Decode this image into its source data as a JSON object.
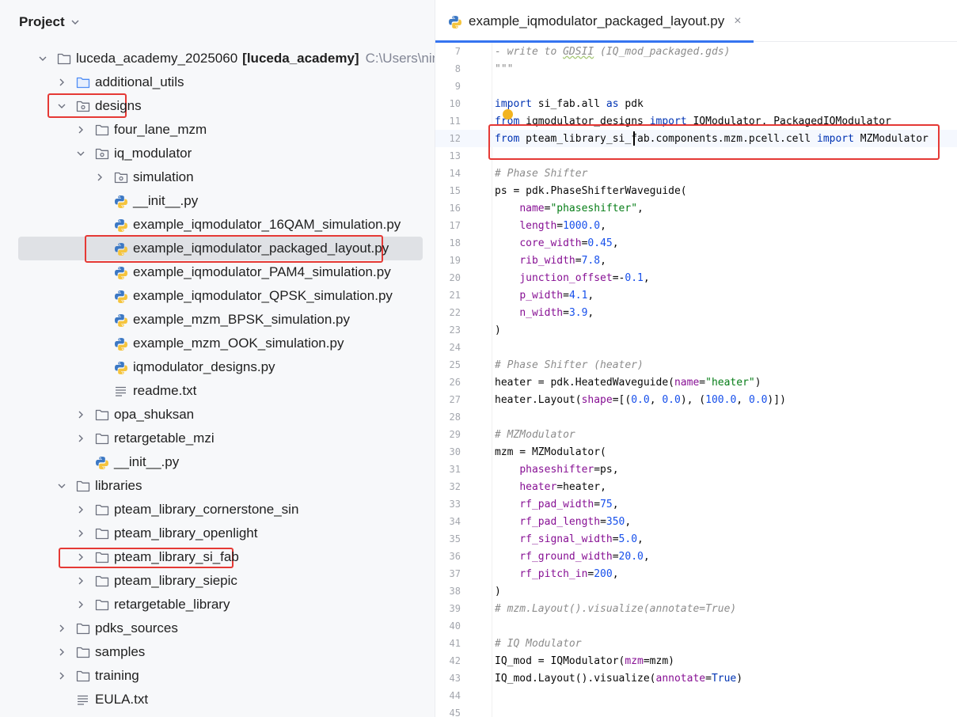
{
  "project_panel": {
    "title": "Project",
    "tree": [
      {
        "depth": 0,
        "expanded": true,
        "icon": "folder",
        "label": "luceda_academy_2025060",
        "suffix_bold": "[luceda_academy]",
        "suffix_path": "C:\\Users\\ning_\\lu"
      },
      {
        "depth": 1,
        "expanded": false,
        "icon": "folder-blue",
        "label": "additional_utils"
      },
      {
        "depth": 1,
        "expanded": true,
        "icon": "package",
        "label": "designs"
      },
      {
        "depth": 2,
        "expanded": false,
        "icon": "folder",
        "label": "four_lane_mzm"
      },
      {
        "depth": 2,
        "expanded": true,
        "icon": "package",
        "label": "iq_modulator"
      },
      {
        "depth": 3,
        "expanded": false,
        "icon": "package",
        "label": "simulation"
      },
      {
        "depth": 3,
        "expanded": null,
        "icon": "python",
        "label": "__init__.py"
      },
      {
        "depth": 3,
        "expanded": null,
        "icon": "python",
        "label": "example_iqmodulator_16QAM_simulation.py"
      },
      {
        "depth": 3,
        "expanded": null,
        "icon": "python",
        "label": "example_iqmodulator_packaged_layout.py",
        "selected": true
      },
      {
        "depth": 3,
        "expanded": null,
        "icon": "python",
        "label": "example_iqmodulator_PAM4_simulation.py"
      },
      {
        "depth": 3,
        "expanded": null,
        "icon": "python",
        "label": "example_iqmodulator_QPSK_simulation.py"
      },
      {
        "depth": 3,
        "expanded": null,
        "icon": "python",
        "label": "example_mzm_BPSK_simulation.py"
      },
      {
        "depth": 3,
        "expanded": null,
        "icon": "python",
        "label": "example_mzm_OOK_simulation.py"
      },
      {
        "depth": 3,
        "expanded": null,
        "icon": "python",
        "label": "iqmodulator_designs.py"
      },
      {
        "depth": 3,
        "expanded": null,
        "icon": "text",
        "label": "readme.txt"
      },
      {
        "depth": 2,
        "expanded": false,
        "icon": "folder",
        "label": "opa_shuksan"
      },
      {
        "depth": 2,
        "expanded": false,
        "icon": "folder",
        "label": "retargetable_mzi"
      },
      {
        "depth": 2,
        "expanded": null,
        "icon": "python",
        "label": "__init__.py"
      },
      {
        "depth": 1,
        "expanded": true,
        "icon": "folder",
        "label": "libraries"
      },
      {
        "depth": 2,
        "expanded": false,
        "icon": "folder",
        "label": "pteam_library_cornerstone_sin"
      },
      {
        "depth": 2,
        "expanded": false,
        "icon": "folder",
        "label": "pteam_library_openlight"
      },
      {
        "depth": 2,
        "expanded": false,
        "icon": "folder",
        "label": "pteam_library_si_fab"
      },
      {
        "depth": 2,
        "expanded": false,
        "icon": "folder",
        "label": "pteam_library_siepic"
      },
      {
        "depth": 2,
        "expanded": false,
        "icon": "folder",
        "label": "retargetable_library"
      },
      {
        "depth": 1,
        "expanded": false,
        "icon": "folder",
        "label": "pdks_sources"
      },
      {
        "depth": 1,
        "expanded": false,
        "icon": "folder",
        "label": "samples"
      },
      {
        "depth": 1,
        "expanded": false,
        "icon": "folder",
        "label": "training"
      },
      {
        "depth": 1,
        "expanded": null,
        "icon": "text",
        "label": "EULA.txt"
      }
    ]
  },
  "editor": {
    "tab_label": "example_iqmodulator_packaged_layout.py",
    "tab_close": "×",
    "current_line": 12,
    "lines": [
      {
        "n": "7",
        "tokens": [
          [
            "com",
            "- write to "
          ],
          [
            "com squig",
            "GDSII"
          ],
          [
            "com",
            " (IQ_mod_packaged.gds)"
          ]
        ]
      },
      {
        "n": "8",
        "tokens": [
          [
            "com",
            "\"\"\""
          ]
        ]
      },
      {
        "n": "9",
        "tokens": []
      },
      {
        "n": "10",
        "tokens": [
          [
            "kw",
            "import"
          ],
          [
            "",
            " si_fab.all "
          ],
          [
            "kw",
            "as"
          ],
          [
            "",
            " pdk"
          ]
        ]
      },
      {
        "n": "11",
        "tokens": [
          [
            "kw",
            "from"
          ],
          [
            "",
            " iqmodulator_designs "
          ],
          [
            "kw",
            "import"
          ],
          [
            "",
            " IQModulator, PackagedIQModulator"
          ]
        ]
      },
      {
        "n": "12",
        "tokens": [
          [
            "kw",
            "from"
          ],
          [
            "",
            " pteam_library_si_fab.components.mzm.pcell.cell "
          ],
          [
            "kw",
            "import"
          ],
          [
            "",
            " MZModulator"
          ]
        ]
      },
      {
        "n": "13",
        "tokens": []
      },
      {
        "n": "14",
        "tokens": [
          [
            "com",
            "# Phase Shifter"
          ]
        ]
      },
      {
        "n": "15",
        "tokens": [
          [
            "",
            "ps = pdk.PhaseShifterWaveguide("
          ]
        ]
      },
      {
        "n": "16",
        "tokens": [
          [
            "",
            "    "
          ],
          [
            "par",
            "name"
          ],
          [
            "",
            "="
          ],
          [
            "str",
            "\"phaseshifter\""
          ],
          [
            "",
            ","
          ]
        ]
      },
      {
        "n": "17",
        "tokens": [
          [
            "",
            "    "
          ],
          [
            "par",
            "length"
          ],
          [
            "",
            "="
          ],
          [
            "num",
            "1000.0"
          ],
          [
            "",
            ","
          ]
        ]
      },
      {
        "n": "18",
        "tokens": [
          [
            "",
            "    "
          ],
          [
            "par",
            "core_width"
          ],
          [
            "",
            "="
          ],
          [
            "num",
            "0.45"
          ],
          [
            "",
            ","
          ]
        ]
      },
      {
        "n": "19",
        "tokens": [
          [
            "",
            "    "
          ],
          [
            "par",
            "rib_width"
          ],
          [
            "",
            "="
          ],
          [
            "num",
            "7.8"
          ],
          [
            "",
            ","
          ]
        ]
      },
      {
        "n": "20",
        "tokens": [
          [
            "",
            "    "
          ],
          [
            "par",
            "junction_offset"
          ],
          [
            "",
            "=-"
          ],
          [
            "num",
            "0.1"
          ],
          [
            "",
            ","
          ]
        ]
      },
      {
        "n": "21",
        "tokens": [
          [
            "",
            "    "
          ],
          [
            "par",
            "p_width"
          ],
          [
            "",
            "="
          ],
          [
            "num",
            "4.1"
          ],
          [
            "",
            ","
          ]
        ]
      },
      {
        "n": "22",
        "tokens": [
          [
            "",
            "    "
          ],
          [
            "par",
            "n_width"
          ],
          [
            "",
            "="
          ],
          [
            "num",
            "3.9"
          ],
          [
            "",
            ","
          ]
        ]
      },
      {
        "n": "23",
        "tokens": [
          [
            "",
            ")"
          ]
        ]
      },
      {
        "n": "24",
        "tokens": []
      },
      {
        "n": "25",
        "tokens": [
          [
            "com",
            "# Phase Shifter (heater)"
          ]
        ]
      },
      {
        "n": "26",
        "tokens": [
          [
            "",
            "heater = pdk.HeatedWaveguide("
          ],
          [
            "par",
            "name"
          ],
          [
            "",
            "="
          ],
          [
            "str",
            "\"heater\""
          ],
          [
            "",
            ")"
          ]
        ]
      },
      {
        "n": "27",
        "tokens": [
          [
            "",
            "heater.Layout("
          ],
          [
            "par",
            "shape"
          ],
          [
            "",
            "=[("
          ],
          [
            "num",
            "0.0"
          ],
          [
            "",
            ", "
          ],
          [
            "num",
            "0.0"
          ],
          [
            "",
            "), ("
          ],
          [
            "num",
            "100.0"
          ],
          [
            "",
            ", "
          ],
          [
            "num",
            "0.0"
          ],
          [
            "",
            ")])"
          ]
        ]
      },
      {
        "n": "28",
        "tokens": []
      },
      {
        "n": "29",
        "tokens": [
          [
            "com",
            "# MZModulator"
          ]
        ]
      },
      {
        "n": "30",
        "tokens": [
          [
            "",
            "mzm = MZModulator("
          ]
        ]
      },
      {
        "n": "31",
        "tokens": [
          [
            "",
            "    "
          ],
          [
            "par",
            "phaseshifter"
          ],
          [
            "",
            "=ps,"
          ]
        ]
      },
      {
        "n": "32",
        "tokens": [
          [
            "",
            "    "
          ],
          [
            "par",
            "heater"
          ],
          [
            "",
            "=heater,"
          ]
        ]
      },
      {
        "n": "33",
        "tokens": [
          [
            "",
            "    "
          ],
          [
            "par",
            "rf_pad_width"
          ],
          [
            "",
            "="
          ],
          [
            "num",
            "75"
          ],
          [
            "",
            ","
          ]
        ]
      },
      {
        "n": "34",
        "tokens": [
          [
            "",
            "    "
          ],
          [
            "par",
            "rf_pad_length"
          ],
          [
            "",
            "="
          ],
          [
            "num",
            "350"
          ],
          [
            "",
            ","
          ]
        ]
      },
      {
        "n": "35",
        "tokens": [
          [
            "",
            "    "
          ],
          [
            "par",
            "rf_signal_width"
          ],
          [
            "",
            "="
          ],
          [
            "num",
            "5.0"
          ],
          [
            "",
            ","
          ]
        ]
      },
      {
        "n": "36",
        "tokens": [
          [
            "",
            "    "
          ],
          [
            "par",
            "rf_ground_width"
          ],
          [
            "",
            "="
          ],
          [
            "num",
            "20.0"
          ],
          [
            "",
            ","
          ]
        ]
      },
      {
        "n": "37",
        "tokens": [
          [
            "",
            "    "
          ],
          [
            "par",
            "rf_pitch_in"
          ],
          [
            "",
            "="
          ],
          [
            "num",
            "200"
          ],
          [
            "",
            ","
          ]
        ]
      },
      {
        "n": "38",
        "tokens": [
          [
            "",
            ")"
          ]
        ]
      },
      {
        "n": "39",
        "tokens": [
          [
            "com",
            "# mzm.Layout().visualize(annotate=True)"
          ]
        ]
      },
      {
        "n": "40",
        "tokens": []
      },
      {
        "n": "41",
        "tokens": [
          [
            "com",
            "# IQ Modulator"
          ]
        ]
      },
      {
        "n": "42",
        "tokens": [
          [
            "",
            "IQ_mod = IQModulator("
          ],
          [
            "par",
            "mzm"
          ],
          [
            "",
            "=mzm)"
          ]
        ]
      },
      {
        "n": "43",
        "tokens": [
          [
            "",
            "IQ_mod.Layout().visualize("
          ],
          [
            "par",
            "annotate"
          ],
          [
            "",
            "="
          ],
          [
            "kw",
            "True"
          ],
          [
            "",
            ")"
          ]
        ]
      },
      {
        "n": "44",
        "tokens": []
      },
      {
        "n": "45",
        "tokens": []
      }
    ]
  },
  "colors": {
    "accent": "#3574f0",
    "highlight_box": "#e53935",
    "folder": "#6c707e",
    "folder_blue": "#4f8df5",
    "python_blue": "#3c78c4",
    "python_yellow": "#f5c43d"
  }
}
